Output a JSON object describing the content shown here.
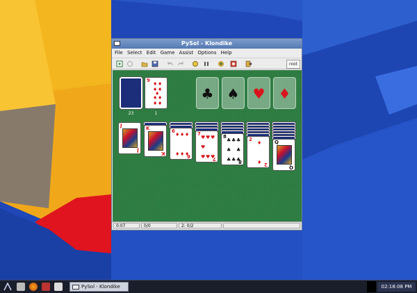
{
  "window": {
    "title": "PySol - Klondike",
    "close_glyph": "✕",
    "maximize_glyph": "□",
    "minimize_glyph": "–"
  },
  "menu": [
    "File",
    "Select",
    "Edit",
    "Game",
    "Assist",
    "Options",
    "Help"
  ],
  "toolbar": {
    "icons": [
      "new-game-icon",
      "restart-icon",
      "open-icon",
      "save-icon",
      "undo-icon",
      "redo-icon",
      "autodrop-icon",
      "pause-icon",
      "statistics-icon",
      "rules-icon",
      "quit-icon"
    ],
    "user": "root"
  },
  "stock": {
    "count": "23"
  },
  "waste": {
    "count": "1",
    "card": {
      "rank": "9",
      "suit": "♦",
      "color": "red"
    }
  },
  "foundations": [
    {
      "suit": "♣",
      "color": "blk"
    },
    {
      "suit": "♠",
      "color": "blk"
    },
    {
      "suit": "♥",
      "color": "red"
    },
    {
      "suit": "♦",
      "color": "red"
    }
  ],
  "tableau": [
    {
      "hidden": 0,
      "card": {
        "rank": "J",
        "suit": "♦",
        "color": "red",
        "face": true
      }
    },
    {
      "hidden": 1,
      "card": {
        "rank": "K",
        "suit": "♦",
        "color": "red",
        "face": true
      }
    },
    {
      "hidden": 2,
      "card": {
        "rank": "6",
        "suit": "♦",
        "color": "red",
        "face": false
      }
    },
    {
      "hidden": 3,
      "card": {
        "rank": "7",
        "suit": "♥",
        "color": "red",
        "face": false
      }
    },
    {
      "hidden": 4,
      "card": {
        "rank": "8",
        "suit": "♣",
        "color": "blk",
        "face": false
      }
    },
    {
      "hidden": 5,
      "card": {
        "rank": "2",
        "suit": "♦",
        "color": "red",
        "face": false
      }
    },
    {
      "hidden": 6,
      "card": {
        "rank": "Q",
        "suit": "♠",
        "color": "blk",
        "face": true
      }
    }
  ],
  "status": {
    "time": "0:07",
    "moves": "0/0",
    "stats": "2: 0/2"
  },
  "taskbar": {
    "task": "PySol - Klondike",
    "clock": "02:18:08 PM"
  },
  "colors": {
    "felt": "#2b7a3f",
    "card_back": "#1c2e7a",
    "title": "#5479b3"
  }
}
